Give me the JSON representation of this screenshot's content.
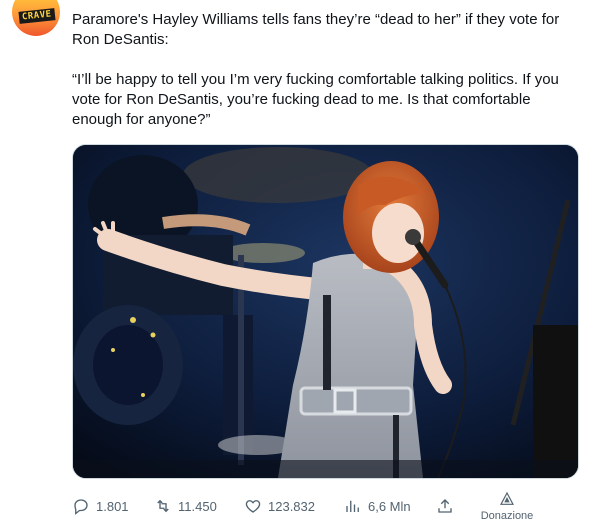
{
  "account": {
    "avatar_text": "CRAVE",
    "avatar_colors": [
      "#ffd23a",
      "#ff9a3a",
      "#f0572c"
    ]
  },
  "tweet": {
    "headline": "Paramore's Hayley Williams tells fans they’re “dead to her” if they vote for Ron DeSantis:",
    "quote": "“I’ll be happy to tell you I’m very fucking comfortable talking politics. If you vote for Ron DeSantis, you’re fucking dead to me. Is that comfortable enough for anyone?”"
  },
  "actions": {
    "replies": "1.801",
    "retweets": "11.450",
    "likes": "123.832",
    "views": "6,6 Mln",
    "donate_label": "Donazione"
  },
  "icons": {
    "reply": "reply-icon",
    "retweet": "retweet-icon",
    "like": "heart-icon",
    "views": "views-chart-icon",
    "share": "share-icon",
    "donate": "donate-icon"
  },
  "colors": {
    "text": "#0f1419",
    "muted": "#536471",
    "media_border": "#cfd9de"
  }
}
